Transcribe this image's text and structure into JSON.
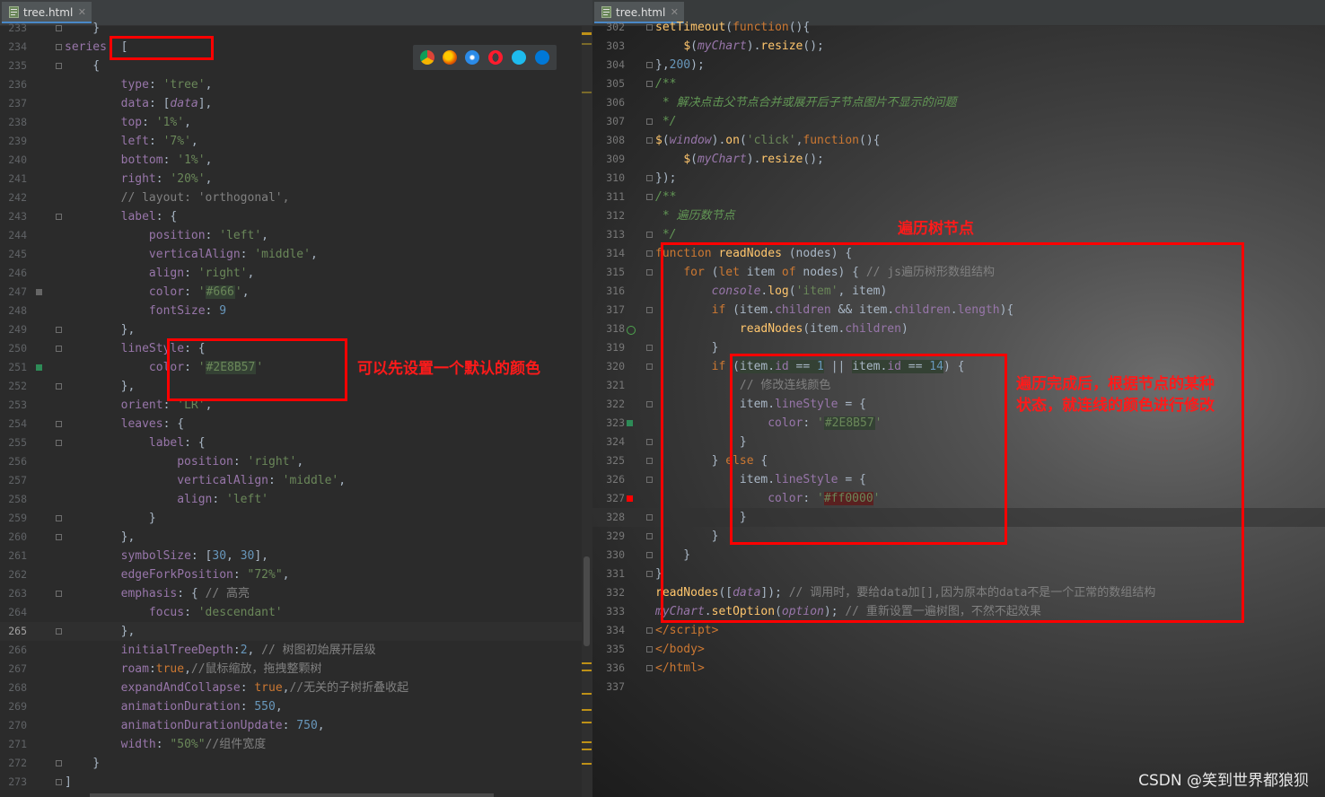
{
  "tabs": {
    "left": {
      "label": "tree.html"
    },
    "right": {
      "label": "tree.html"
    }
  },
  "left_lines": [
    {
      "num": "233",
      "html": "    }",
      "fold": true
    },
    {
      "num": "234",
      "html": "<span class=\"p\">series</span>: [",
      "fold": true
    },
    {
      "num": "235",
      "html": "    {",
      "fold": true
    },
    {
      "num": "236",
      "html": "        <span class=\"p\">type</span>: <span class=\"s\">'tree'</span>,"
    },
    {
      "num": "237",
      "html": "        <span class=\"p\">data</span>: [<span class=\"p it\">data</span>],"
    },
    {
      "num": "238",
      "html": "        <span class=\"p\">top</span>: <span class=\"s\">'1%'</span>,"
    },
    {
      "num": "239",
      "html": "        <span class=\"p\">left</span>: <span class=\"s\">'7%'</span>,"
    },
    {
      "num": "240",
      "html": "        <span class=\"p\">bottom</span>: <span class=\"s\">'1%'</span>,"
    },
    {
      "num": "241",
      "html": "        <span class=\"p\">right</span>: <span class=\"s\">'20%'</span>,"
    },
    {
      "num": "242",
      "html": "        <span class=\"c\">// layout: 'orthogonal',</span>"
    },
    {
      "num": "243",
      "html": "        <span class=\"p\">label</span>: {",
      "fold": true
    },
    {
      "num": "244",
      "html": "            <span class=\"p\">position</span>: <span class=\"s\">'left'</span>,"
    },
    {
      "num": "245",
      "html": "            <span class=\"p\">verticalAlign</span>: <span class=\"s\">'middle'</span>,"
    },
    {
      "num": "246",
      "html": "            <span class=\"p\">align</span>: <span class=\"s\">'right'</span>,"
    },
    {
      "num": "247",
      "html": "            <span class=\"p\">color</span>: <span class=\"s\">'<span class=\"hexbox\">#666</span>'</span>,",
      "mark": "#666666"
    },
    {
      "num": "248",
      "html": "            <span class=\"p\">fontSize</span>: <span class=\"n\">9</span>"
    },
    {
      "num": "249",
      "html": "        },",
      "fold": true
    },
    {
      "num": "250",
      "html": "        <span class=\"p\">lineStyle</span>: {",
      "fold": true
    },
    {
      "num": "251",
      "html": "            <span class=\"p\">color</span>: <span class=\"s\">'<span class=\"hexbox\">#2E8B57</span>'</span>",
      "mark": "#2E8B57"
    },
    {
      "num": "252",
      "html": "        },",
      "fold": true
    },
    {
      "num": "253",
      "html": "        <span class=\"p\">orient</span>: <span class=\"s\">'LR'</span>,"
    },
    {
      "num": "254",
      "html": "        <span class=\"p\">leaves</span>: {",
      "fold": true
    },
    {
      "num": "255",
      "html": "            <span class=\"p\">label</span>: {",
      "fold": true
    },
    {
      "num": "256",
      "html": "                <span class=\"p\">position</span>: <span class=\"s\">'right'</span>,"
    },
    {
      "num": "257",
      "html": "                <span class=\"p\">verticalAlign</span>: <span class=\"s\">'middle'</span>,"
    },
    {
      "num": "258",
      "html": "                <span class=\"p\">align</span>: <span class=\"s\">'left'</span>"
    },
    {
      "num": "259",
      "html": "            }",
      "fold": true
    },
    {
      "num": "260",
      "html": "        },",
      "fold": true
    },
    {
      "num": "261",
      "html": "        <span class=\"p\">symbolSize</span>: [<span class=\"n\">30</span>, <span class=\"n\">30</span>],"
    },
    {
      "num": "262",
      "html": "        <span class=\"p\">edgeForkPosition</span>: <span class=\"s\">\"72%\"</span>,"
    },
    {
      "num": "263",
      "html": "        <span class=\"p\">emphasis</span>: { <span class=\"c\">// 高亮</span>",
      "fold": true
    },
    {
      "num": "264",
      "html": "            <span class=\"p\">focus</span>: <span class=\"s\">'descendant'</span>"
    },
    {
      "num": "265",
      "html": "        },",
      "fold": true,
      "current": true
    },
    {
      "num": "266",
      "html": "        <span class=\"p\">initialTreeDepth</span>:<span class=\"n\">2</span>, <span class=\"c\">// 树图初始展开层级</span>"
    },
    {
      "num": "267",
      "html": "        <span class=\"p\">roam</span>:<span class=\"k\">true</span>,<span class=\"c\">//鼠标缩放，拖拽整颗树</span>"
    },
    {
      "num": "268",
      "html": "        <span class=\"p\">expandAndCollapse</span>: <span class=\"k\">true</span>,<span class=\"c\">//无关的子树折叠收起</span>"
    },
    {
      "num": "269",
      "html": "        <span class=\"p\">animationDuration</span>: <span class=\"n\">550</span>,"
    },
    {
      "num": "270",
      "html": "        <span class=\"p\">animationDurationUpdate</span>: <span class=\"n\">750</span>,"
    },
    {
      "num": "271",
      "html": "        <span class=\"p\">width</span>: <span class=\"s\">\"50%\"</span><span class=\"c\">//组件宽度</span>"
    },
    {
      "num": "272",
      "html": "    }",
      "fold": true
    },
    {
      "num": "273",
      "html": "]",
      "fold": true
    }
  ],
  "right_lines": [
    {
      "num": "302",
      "html": "<span class=\"f\">setTimeout</span>(<span class=\"k\">function</span>(){",
      "fold": true
    },
    {
      "num": "303",
      "html": "    <span class=\"f\">$</span>(<span class=\"p it\">myChart</span>).<span class=\"f\">resize</span>();"
    },
    {
      "num": "304",
      "html": "},<span class=\"n\">200</span>);",
      "fold": true
    },
    {
      "num": "305",
      "html": "<span class=\"cd\">/**</span>",
      "fold": true
    },
    {
      "num": "306",
      "html": "<span class=\"cd\"> * 解决点击父节点合并或展开后子节点图片不显示的问题</span>"
    },
    {
      "num": "307",
      "html": "<span class=\"cd\"> */</span>",
      "fold": true
    },
    {
      "num": "308",
      "html": "<span class=\"f\">$</span>(<span class=\"p it\">window</span>).<span class=\"f\">on</span>(<span class=\"s\">'click'</span>,<span class=\"k\">function</span>(){",
      "fold": true
    },
    {
      "num": "309",
      "html": "    <span class=\"f\">$</span>(<span class=\"p it\">myChart</span>).<span class=\"f\">resize</span>();"
    },
    {
      "num": "310",
      "html": "});",
      "fold": true
    },
    {
      "num": "311",
      "html": "<span class=\"cd\">/**</span>",
      "fold": true
    },
    {
      "num": "312",
      "html": "<span class=\"cd\"> * 遍历数节点</span>"
    },
    {
      "num": "313",
      "html": "<span class=\"cd\"> */</span>",
      "fold": true
    },
    {
      "num": "314",
      "html": "<span class=\"k\">function</span> <span class=\"f\">readNodes</span> (nodes) {",
      "fold": true
    },
    {
      "num": "315",
      "html": "    <span class=\"k\">for</span> (<span class=\"k\">let</span> item <span class=\"k\">of</span> nodes) { <span class=\"c\">// js遍历树形数组结构</span>",
      "fold": true
    },
    {
      "num": "316",
      "html": "        <span class=\"p it\">console</span>.<span class=\"f\">log</span>(<span class=\"s\">'item'</span>, item)"
    },
    {
      "num": "317",
      "html": "        <span class=\"k\">if</span> (item.<span class=\"p\">children</span> &amp;&amp; item.<span class=\"p\">children</span>.<span class=\"p\">length</span>){",
      "fold": true
    },
    {
      "num": "318",
      "html": "            <span class=\"f\">readNodes</span>(item.<span class=\"p\">children</span>)",
      "recur": true
    },
    {
      "num": "319",
      "html": "        }",
      "fold": true
    },
    {
      "num": "320",
      "html": "        <span class=\"k\">if</span> (<span class=\"hl\">item.<span class=\"p\">id</span> == <span class=\"n\">1</span></span> || <span class=\"hl\">item.<span class=\"p\">id</span> == <span class=\"n\">14</span></span>) {",
      "fold": true
    },
    {
      "num": "321",
      "html": "            <span class=\"c\">// 修改连线颜色</span>"
    },
    {
      "num": "322",
      "html": "            item.<span class=\"p\">lineStyle</span> = {",
      "fold": true
    },
    {
      "num": "323",
      "html": "                <span class=\"p\">color</span>: <span class=\"s\">'<span class=\"hexbox\">#2E8B57</span>'</span>",
      "mark": "#2E8B57"
    },
    {
      "num": "324",
      "html": "            }",
      "fold": true
    },
    {
      "num": "325",
      "html": "        } <span class=\"k\">else</span> {",
      "fold": true
    },
    {
      "num": "326",
      "html": "            item.<span class=\"p\">lineStyle</span> = {",
      "fold": true
    },
    {
      "num": "327",
      "html": "                <span class=\"p\">color</span>: <span class=\"s\">'<span class=\"chip-red\">#ff0000</span>'</span>",
      "mark": "#ff0000"
    },
    {
      "num": "328",
      "html": "            }",
      "fold": true,
      "current": true
    },
    {
      "num": "329",
      "html": "        }",
      "fold": true
    },
    {
      "num": "330",
      "html": "    }",
      "fold": true
    },
    {
      "num": "331",
      "html": "}",
      "fold": true
    },
    {
      "num": "332",
      "html": "<span class=\"f\">readNodes</span>([<span class=\"p it\">data</span>]); <span class=\"c\">// 调用时，要给data加[],因为原本的data不是一个正常的数组结构</span>"
    },
    {
      "num": "333",
      "html": "<span class=\"p it\">myChart</span>.<span class=\"f\">setOption</span>(<span class=\"p it\">option</span>); <span class=\"c\">// 重新设置一遍树图，不然不起效果</span>"
    },
    {
      "num": "334",
      "html": "<span class=\"k\">&lt;/script&gt;</span>",
      "fold": true,
      "outdent": true
    },
    {
      "num": "335",
      "html": "<span class=\"k\">&lt;/body&gt;</span>",
      "fold": true,
      "outdent": true
    },
    {
      "num": "336",
      "html": "<span class=\"k\">&lt;/html&gt;</span>",
      "fold": true,
      "outdent": true
    },
    {
      "num": "337",
      "html": ""
    }
  ],
  "annotations": {
    "default_color": "可以先设置一个默认的颜色",
    "traverse_tree": "遍历树节点",
    "after_traverse_line1": "遍历完成后，根据节点的某种",
    "after_traverse_line2": "状态，就连线的颜色进行修改"
  },
  "browser_icons": [
    "chrome-icon",
    "firefox-icon",
    "safari-icon",
    "opera-icon",
    "ie-icon",
    "edge-icon"
  ],
  "watermark": "CSDN @笑到世界都狼狈",
  "colors": {
    "annotation_red": "#ff0000",
    "sea_green": "#2E8B57",
    "gray_666": "#666666"
  }
}
